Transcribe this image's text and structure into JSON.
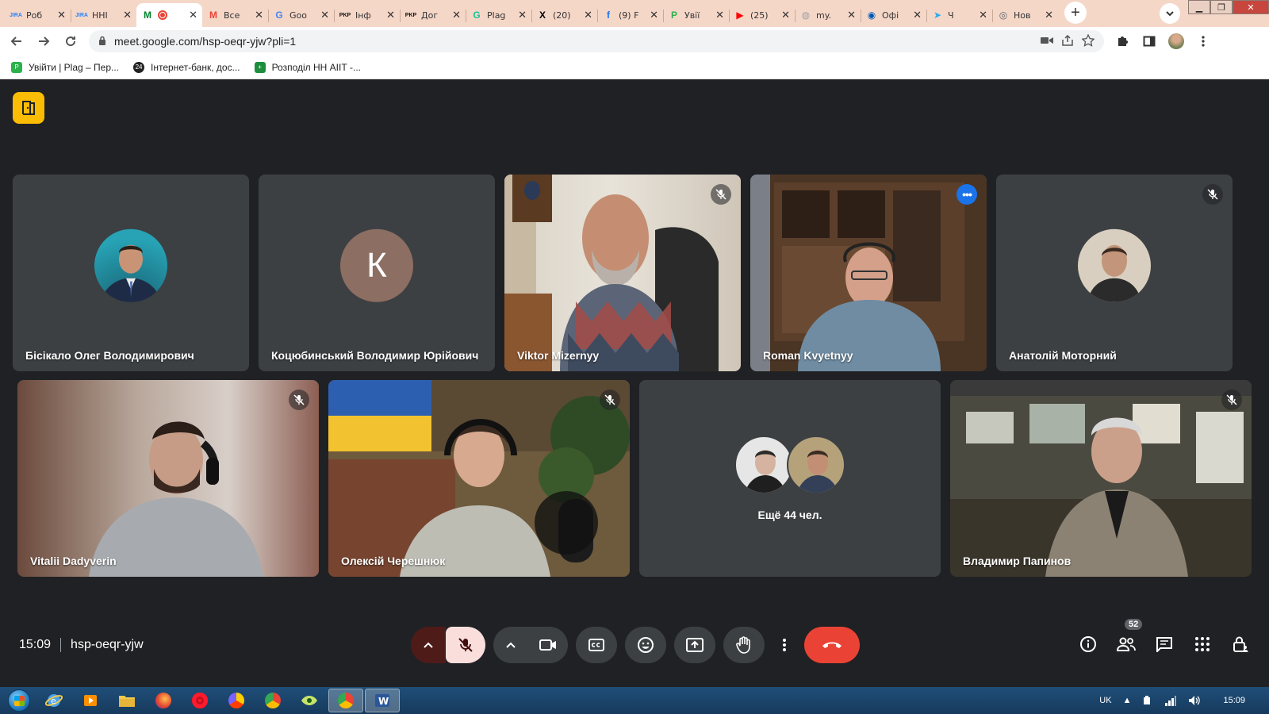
{
  "browser": {
    "tabs": [
      {
        "title": "Роб",
        "favicon": "jira-icon",
        "color": "#2684ff",
        "glyph": "JIRA"
      },
      {
        "title": "ННІ",
        "favicon": "jira-icon",
        "color": "#2684ff",
        "glyph": "JIRA"
      },
      {
        "title": "",
        "favicon": "meet-icon",
        "color": "#00832d",
        "glyph": "M",
        "active": true,
        "recording": true
      },
      {
        "title": "Все",
        "favicon": "gmail-icon",
        "color": "#ea4335",
        "glyph": "M"
      },
      {
        "title": "Goo",
        "favicon": "google-translate-icon",
        "color": "#4285f4",
        "glyph": "G"
      },
      {
        "title": "Інф",
        "favicon": "pkp-icon",
        "color": "#111111",
        "glyph": "PKP"
      },
      {
        "title": "Дог",
        "favicon": "pkp-icon",
        "color": "#111111",
        "glyph": "PKP"
      },
      {
        "title": "Plag",
        "favicon": "grammarly-icon",
        "color": "#15c39a",
        "glyph": "G"
      },
      {
        "title": "(20)",
        "favicon": "x-icon",
        "color": "#000000",
        "glyph": "X"
      },
      {
        "title": "(9) F",
        "favicon": "facebook-icon",
        "color": "#1877f2",
        "glyph": "f"
      },
      {
        "title": "Увії",
        "favicon": "plag-icon",
        "color": "#2bb24c",
        "glyph": "P"
      },
      {
        "title": "(25)",
        "favicon": "youtube-icon",
        "color": "#ff0000",
        "glyph": "▶"
      },
      {
        "title": "my.",
        "favicon": "globe-icon",
        "color": "#9aa0a6",
        "glyph": "◍"
      },
      {
        "title": "Офі",
        "favicon": "ukraine-emblem-icon",
        "color": "#0057b7",
        "glyph": "◉"
      },
      {
        "title": "Ч",
        "favicon": "telegram-icon",
        "color": "#2aabee",
        "glyph": "➤"
      },
      {
        "title": "Нов",
        "favicon": "chrome-icon",
        "color": "#5f6368",
        "glyph": "◎"
      }
    ],
    "url": "meet.google.com/hsp-oeqr-yjw?pli=1",
    "bookmarks": [
      {
        "label": "Увійти | Plag – Пер...",
        "color": "#2bb24c"
      },
      {
        "label": "Інтернет-банк, дос...",
        "color": "#222222",
        "glyph": "24"
      },
      {
        "label": "Розподіл НН АІІТ -...",
        "color": "#1e8e3e"
      }
    ]
  },
  "meet": {
    "tiles_row1": [
      {
        "name": "Бісікало Олег Володимирович",
        "type": "avatar-photo",
        "muted": false
      },
      {
        "name": "Коцюбинський Володимир Юрійович",
        "type": "avatar-letter",
        "letter": "К",
        "muted": false
      },
      {
        "name": "Viktor Mizernyy",
        "type": "video",
        "muted": true
      },
      {
        "name": "Roman Kvyetnyy",
        "type": "video",
        "muted": false,
        "speaking": true
      },
      {
        "name": "Анатолій Моторний",
        "type": "avatar-photo",
        "muted": true
      }
    ],
    "tiles_row2": [
      {
        "name": "Vitalii Dadyverin",
        "type": "video",
        "muted": true
      },
      {
        "name": "Олексій Черешнюк",
        "type": "video",
        "muted": true
      },
      {
        "name": "",
        "type": "others",
        "label": "Ещё 44 чел."
      },
      {
        "name": "Владимир Папинов",
        "type": "video",
        "muted": true
      }
    ],
    "time": "15:09",
    "meeting_code": "hsp-oeqr-yjw",
    "participants_count": "52",
    "colors": {
      "accent": "#8ab4f8",
      "hangup": "#ea4335",
      "background": "#202124",
      "tile": "#3c4043"
    }
  },
  "taskbar": {
    "language": "UK",
    "clock": "15:09"
  }
}
